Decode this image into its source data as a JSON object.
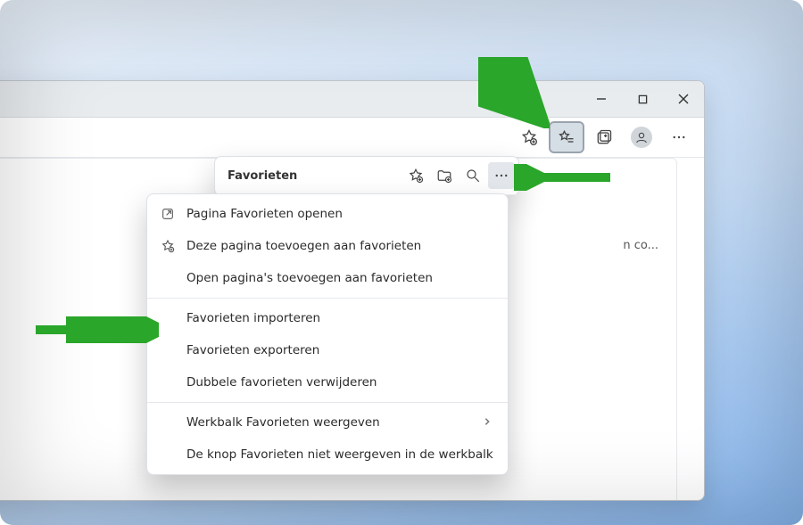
{
  "window": {
    "titlebar": {
      "minimize_name": "minimize-icon",
      "maximize_name": "maximize-icon",
      "close_name": "close-icon"
    }
  },
  "toolbar": {
    "add_favorite_name": "star-plus-icon",
    "favorites_name": "favorites-star-lines-icon",
    "collections_name": "collections-icon",
    "profile_name": "profile-avatar-icon",
    "more_name": "horizontal-dots-icon"
  },
  "content": {
    "partial_row": "n co..."
  },
  "favorites_panel": {
    "title": "Favorieten",
    "header_icons": {
      "pin": "star-plus-icon",
      "add_folder": "folder-plus-icon",
      "search": "search-icon",
      "more": "horizontal-dots-icon"
    }
  },
  "context_menu": {
    "open_page": "Pagina Favorieten openen",
    "add_page": "Deze pagina toevoegen aan favorieten",
    "add_open_pages": "Open pagina's toevoegen aan favorieten",
    "import": "Favorieten importeren",
    "export": "Favorieten exporteren",
    "remove_duplicates": "Dubbele favorieten verwijderen",
    "show_toolbar": "Werkbalk Favorieten weergeven",
    "hide_button": "De knop Favorieten niet weergeven in de werkbalk"
  },
  "annotation_color": "#2aa62a"
}
